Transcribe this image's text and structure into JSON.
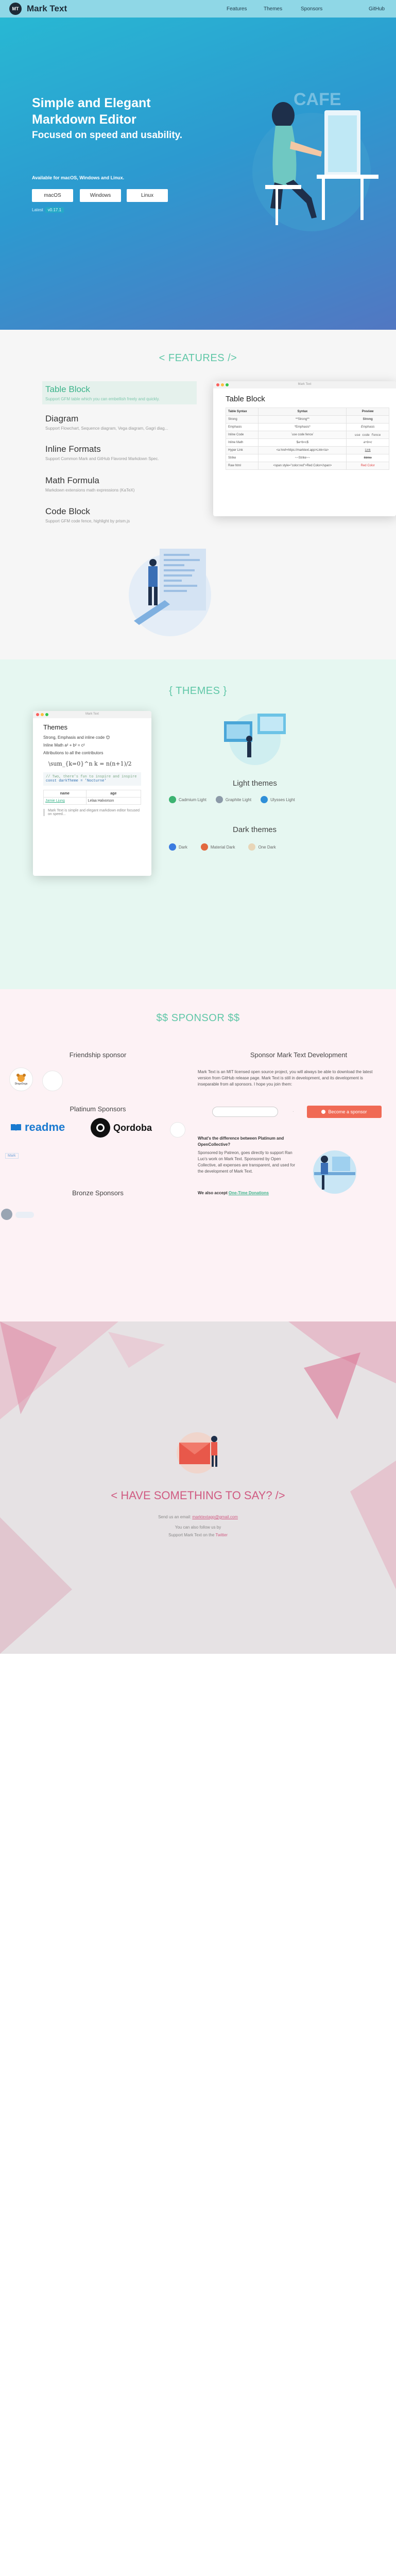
{
  "nav": {
    "brand": "Mark Text",
    "logo_text": "MT",
    "links": [
      "Features",
      "Themes",
      "Sponsors",
      "GitHub"
    ]
  },
  "hero": {
    "title": "Simple and Elegant Markdown Editor",
    "subtitle": "Focused on speed and usability.",
    "available": "Available for macOS, Windows and Linux.",
    "buttons": [
      "macOS",
      "Windows",
      "Linux"
    ],
    "version_label": "Latest",
    "version": "v0.17.1"
  },
  "features": {
    "title": "< FEATURES />",
    "items": [
      {
        "title": "Table Block",
        "desc": "Support GFM table which you can embellish freely and quickly."
      },
      {
        "title": "Diagram",
        "desc": "Support Flowchart, Sequence diagram, Vega diagram, Gagri diag..."
      },
      {
        "title": "Inline Formats",
        "desc": "Support Common Mark and GitHub Flavored Markdown Spec."
      },
      {
        "title": "Math Formula",
        "desc": "Markdown extensions math expressions (KaTeX)"
      },
      {
        "title": "Code Block",
        "desc": "Support GFM code fence, highlight by prism.js"
      }
    ],
    "window_title": "Mark Text",
    "table": {
      "title": "Table Block",
      "headers": [
        "Table Syntax",
        "Syntax",
        "Preview"
      ],
      "rows": [
        [
          "Strong",
          "**Strong**",
          "Strong"
        ],
        [
          "Emphasis",
          "*Emphasis*",
          "Emphasis"
        ],
        [
          "Inline Code",
          "`use code fence`",
          "use code fence"
        ],
        [
          "Inline Math",
          "$a+b=c$",
          "a+b=c"
        ],
        [
          "Hyper Link",
          "<a href=https://marktext.app>Link</a>",
          "Link"
        ],
        [
          "Strike",
          "~~Strike~~",
          "Strike"
        ],
        [
          "Raw html",
          "<span style=\"color:red\">Red Color</span>",
          "Red Color"
        ]
      ]
    }
  },
  "themes": {
    "title": "{ THEMES }",
    "window_title": "Mark Text",
    "window_heading": "Themes",
    "window_lines": [
      "Strong, Emphasis and inline code 😊",
      "Inline Math a² + b² = c²",
      "Attributions to all the contributors",
      "\\sum_{k=0}^n k = n(n+1)/2",
      "// Two, there's fun to inspire and inspire",
      "const darkTheme = 'Nocturne'"
    ],
    "window_table": [
      [
        "name",
        "age"
      ],
      [
        "Jamie Ljung",
        "Lelaa Halvorson"
      ]
    ],
    "window_quote": "Mark Text is simple and elegant markdown editor focused on speed...",
    "light_label": "Light themes",
    "light": [
      {
        "name": "Cadmium Light",
        "color": "#3cb371"
      },
      {
        "name": "Graphite Light",
        "color": "#8c9aa8"
      },
      {
        "name": "Ulysses Light",
        "color": "#2f8fd8"
      }
    ],
    "dark_label": "Dark themes",
    "dark": [
      {
        "name": "Dark",
        "color": "#3b7be0"
      },
      {
        "name": "Material Dark",
        "color": "#e2693f"
      },
      {
        "name": "One Dark",
        "color": "#e8d6b8"
      }
    ]
  },
  "sponsor": {
    "title": "$$ SPONSOR $$",
    "friendship": "Friendship sponsor",
    "platinum": "Platinum Sponsors",
    "bronze": "Bronze Sponsors",
    "sponsor_dev": "Sponsor Mark Text Development",
    "dev_text": "Mark Text is an MIT licensed open source project, you will always be able to download the latest version from GitHub release page. Mark Text is still in development, and its development is inseparable from all sponsors. I hope you join them:",
    "email_placeholder": "",
    "become_button": "Become a sponsor",
    "diff_heading": "What's the difference between Platinum and OpenCollective?",
    "diff_text": "Sponsored by Patreon, goes directly to support Ran Luo's work on Mark Text. Sponsored by Open Collective, all expenses are transparent, and used for the development of Mark Text.",
    "accept_prefix": "We also accept",
    "accept_link": "One-Time Donations",
    "logos": {
      "dingo": "DingoDogs",
      "readme": "readme",
      "qordoba": "Qordoba",
      "mini": "Mark"
    }
  },
  "contact": {
    "say": "< HAVE SOMETHING TO SAY? />",
    "email_prefix": "Send us an email:",
    "email": "marktextapp@gmail.com",
    "line2": "You can also follow us by",
    "line3_prefix": "Support Mark Text on the",
    "line3_link": "Twitter"
  }
}
